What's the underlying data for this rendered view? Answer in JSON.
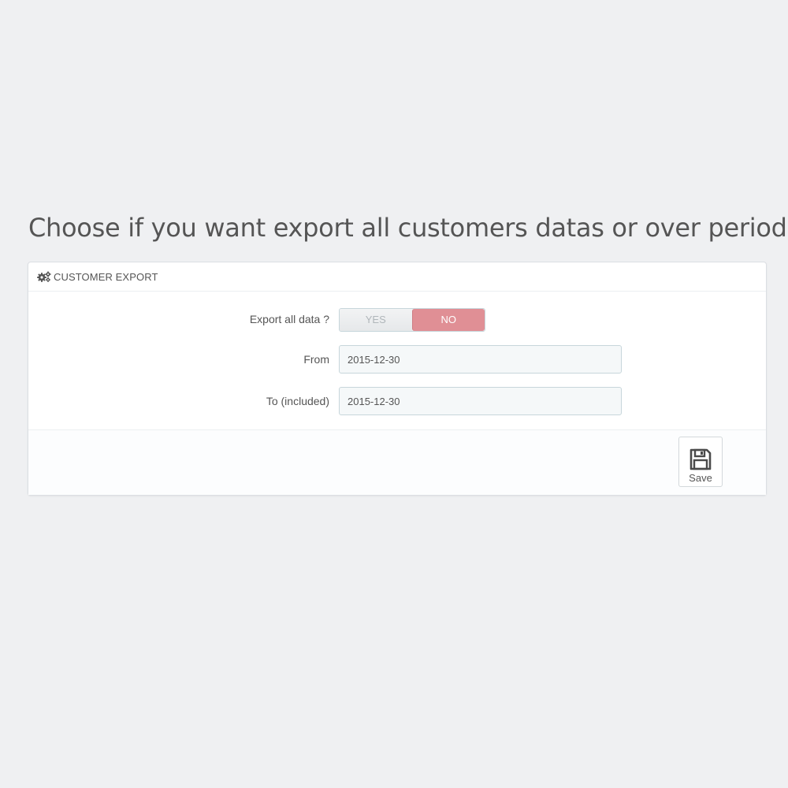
{
  "caption": "Choose if you want export all customers datas or over period",
  "panel": {
    "title": "CUSTOMER EXPORT",
    "icon": "cogs-icon"
  },
  "form": {
    "export_all": {
      "label": "Export all data ?",
      "options": [
        "YES",
        "NO"
      ],
      "selected": "NO"
    },
    "from": {
      "label": "From",
      "value": "2015-12-30"
    },
    "to": {
      "label": "To (included)",
      "value": "2015-12-30"
    }
  },
  "footer": {
    "save_label": "Save",
    "save_icon": "save-icon"
  },
  "colors": {
    "background": "#eff0f2",
    "switch_active": "#e08f95"
  }
}
